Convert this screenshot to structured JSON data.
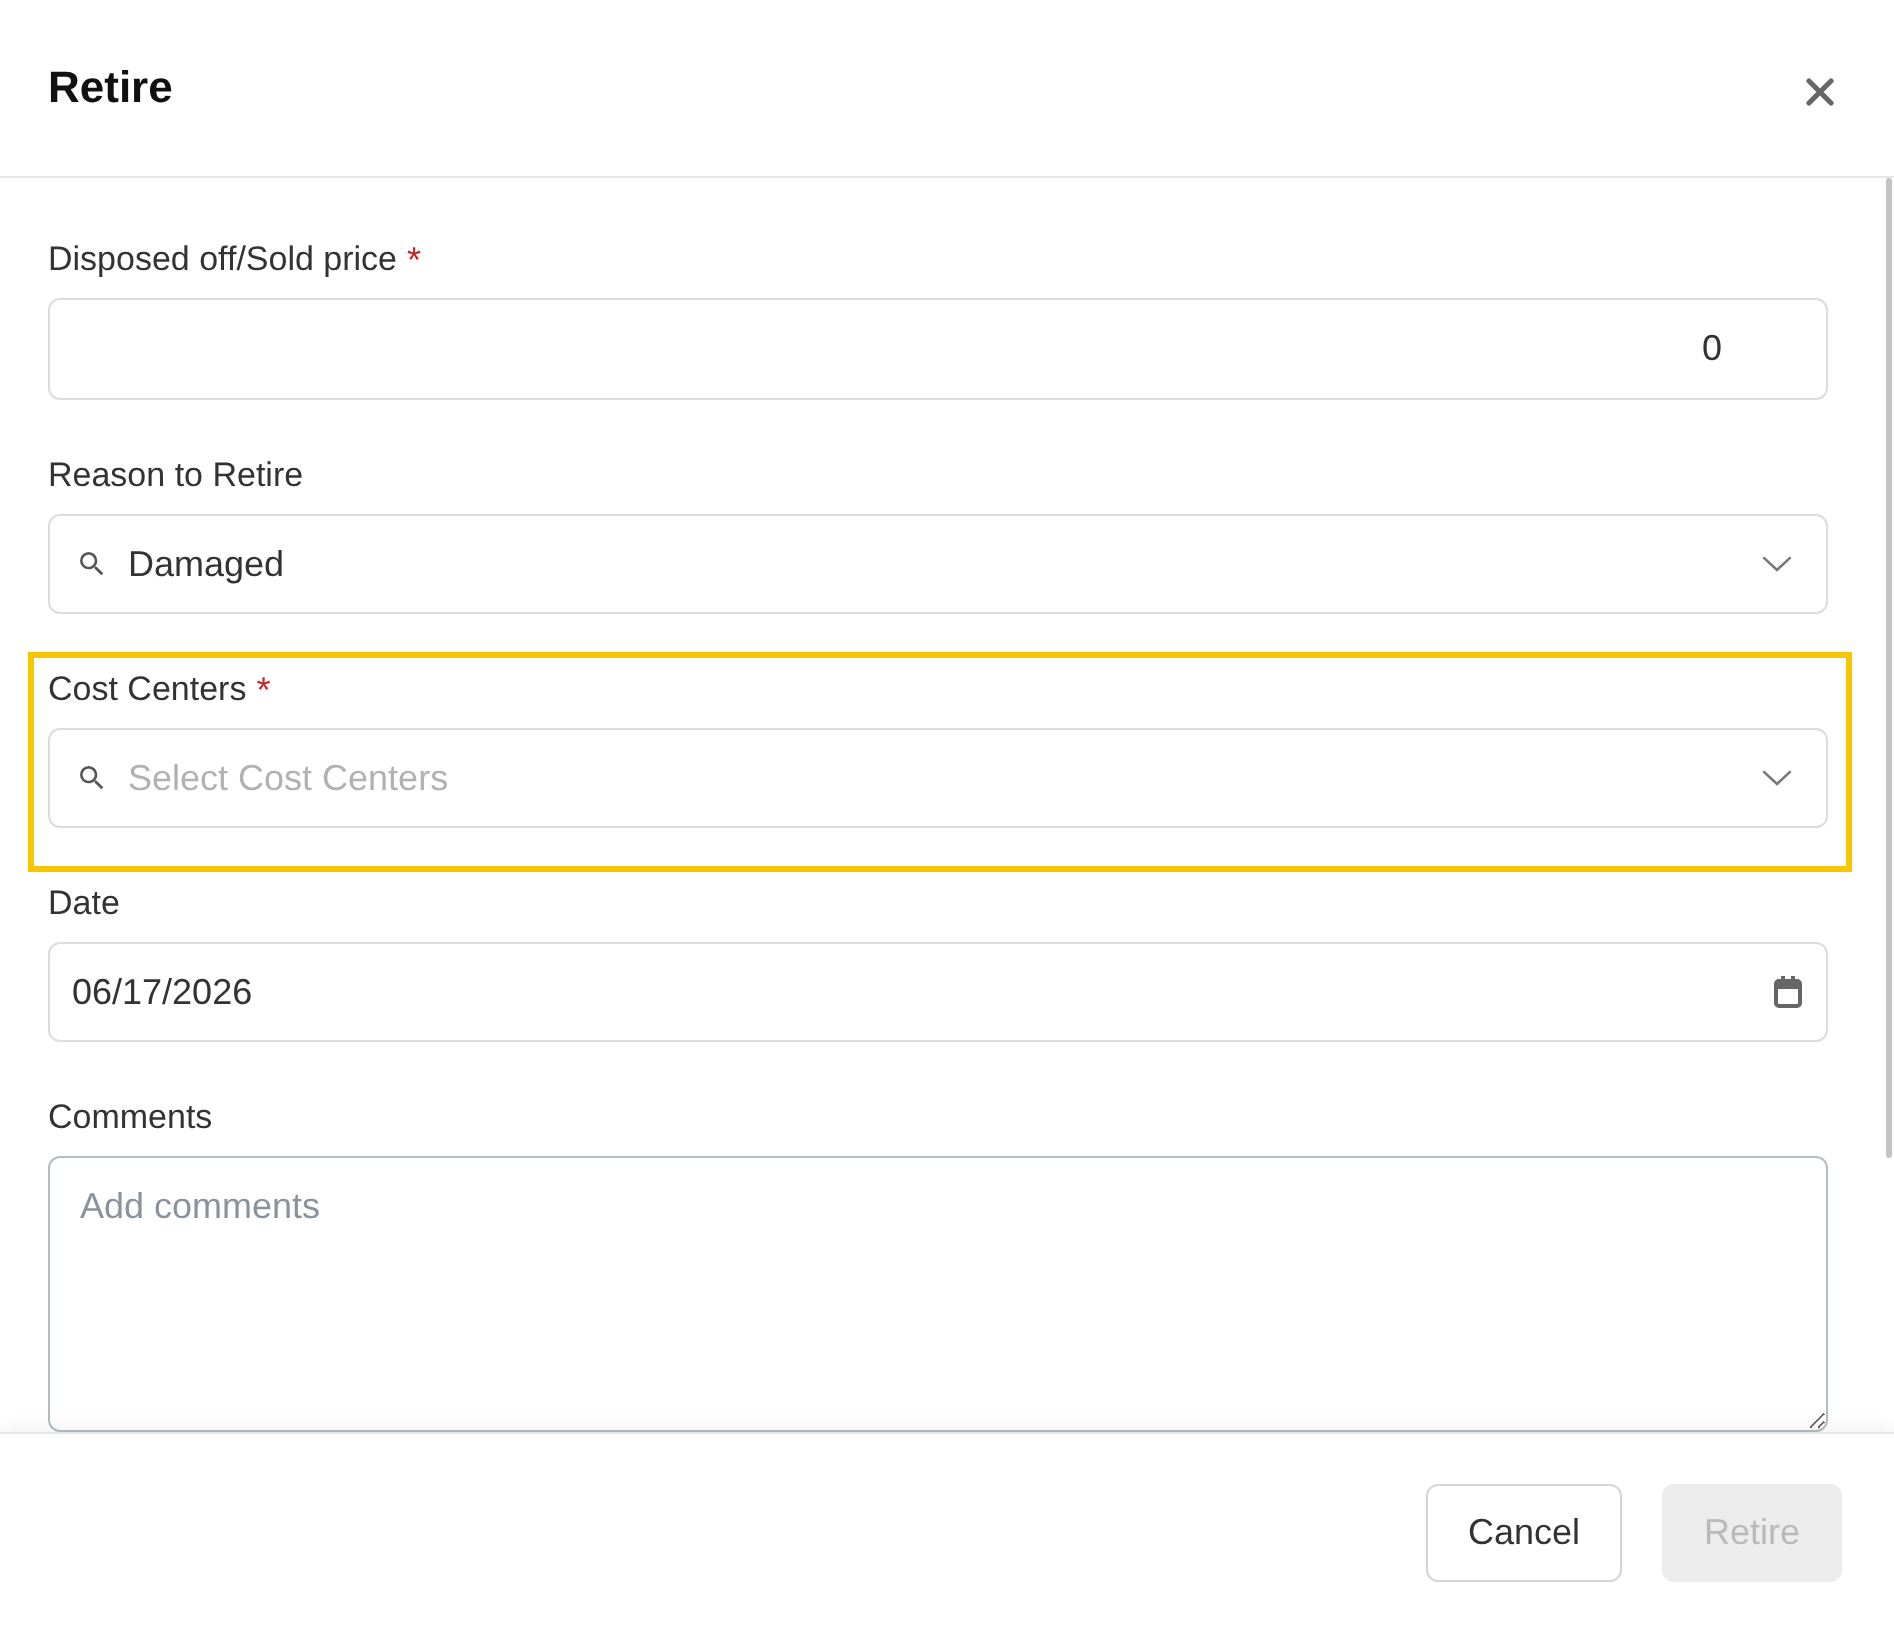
{
  "dialog": {
    "title": "Retire"
  },
  "fields": [
    {
      "kind": "number",
      "label": "Disposed off/Sold price",
      "required_mark": "*",
      "value": "0",
      "highlighted": false
    },
    {
      "kind": "select",
      "label": "Reason to Retire",
      "value": "Damaged",
      "highlighted": false
    },
    {
      "kind": "select",
      "label": "Cost Centers",
      "required_mark": "*",
      "placeholder": "Select Cost Centers",
      "highlighted": true
    },
    {
      "kind": "date",
      "label": "Date",
      "value": "06/17/2026",
      "highlighted": false
    },
    {
      "kind": "textarea",
      "label": "Comments",
      "placeholder": "Add comments",
      "highlighted": false
    }
  ],
  "buttons": [
    {
      "label": "Cancel",
      "kind": "secondary",
      "disabled": false
    },
    {
      "label": "Retire",
      "kind": "primary",
      "disabled": true
    }
  ]
}
